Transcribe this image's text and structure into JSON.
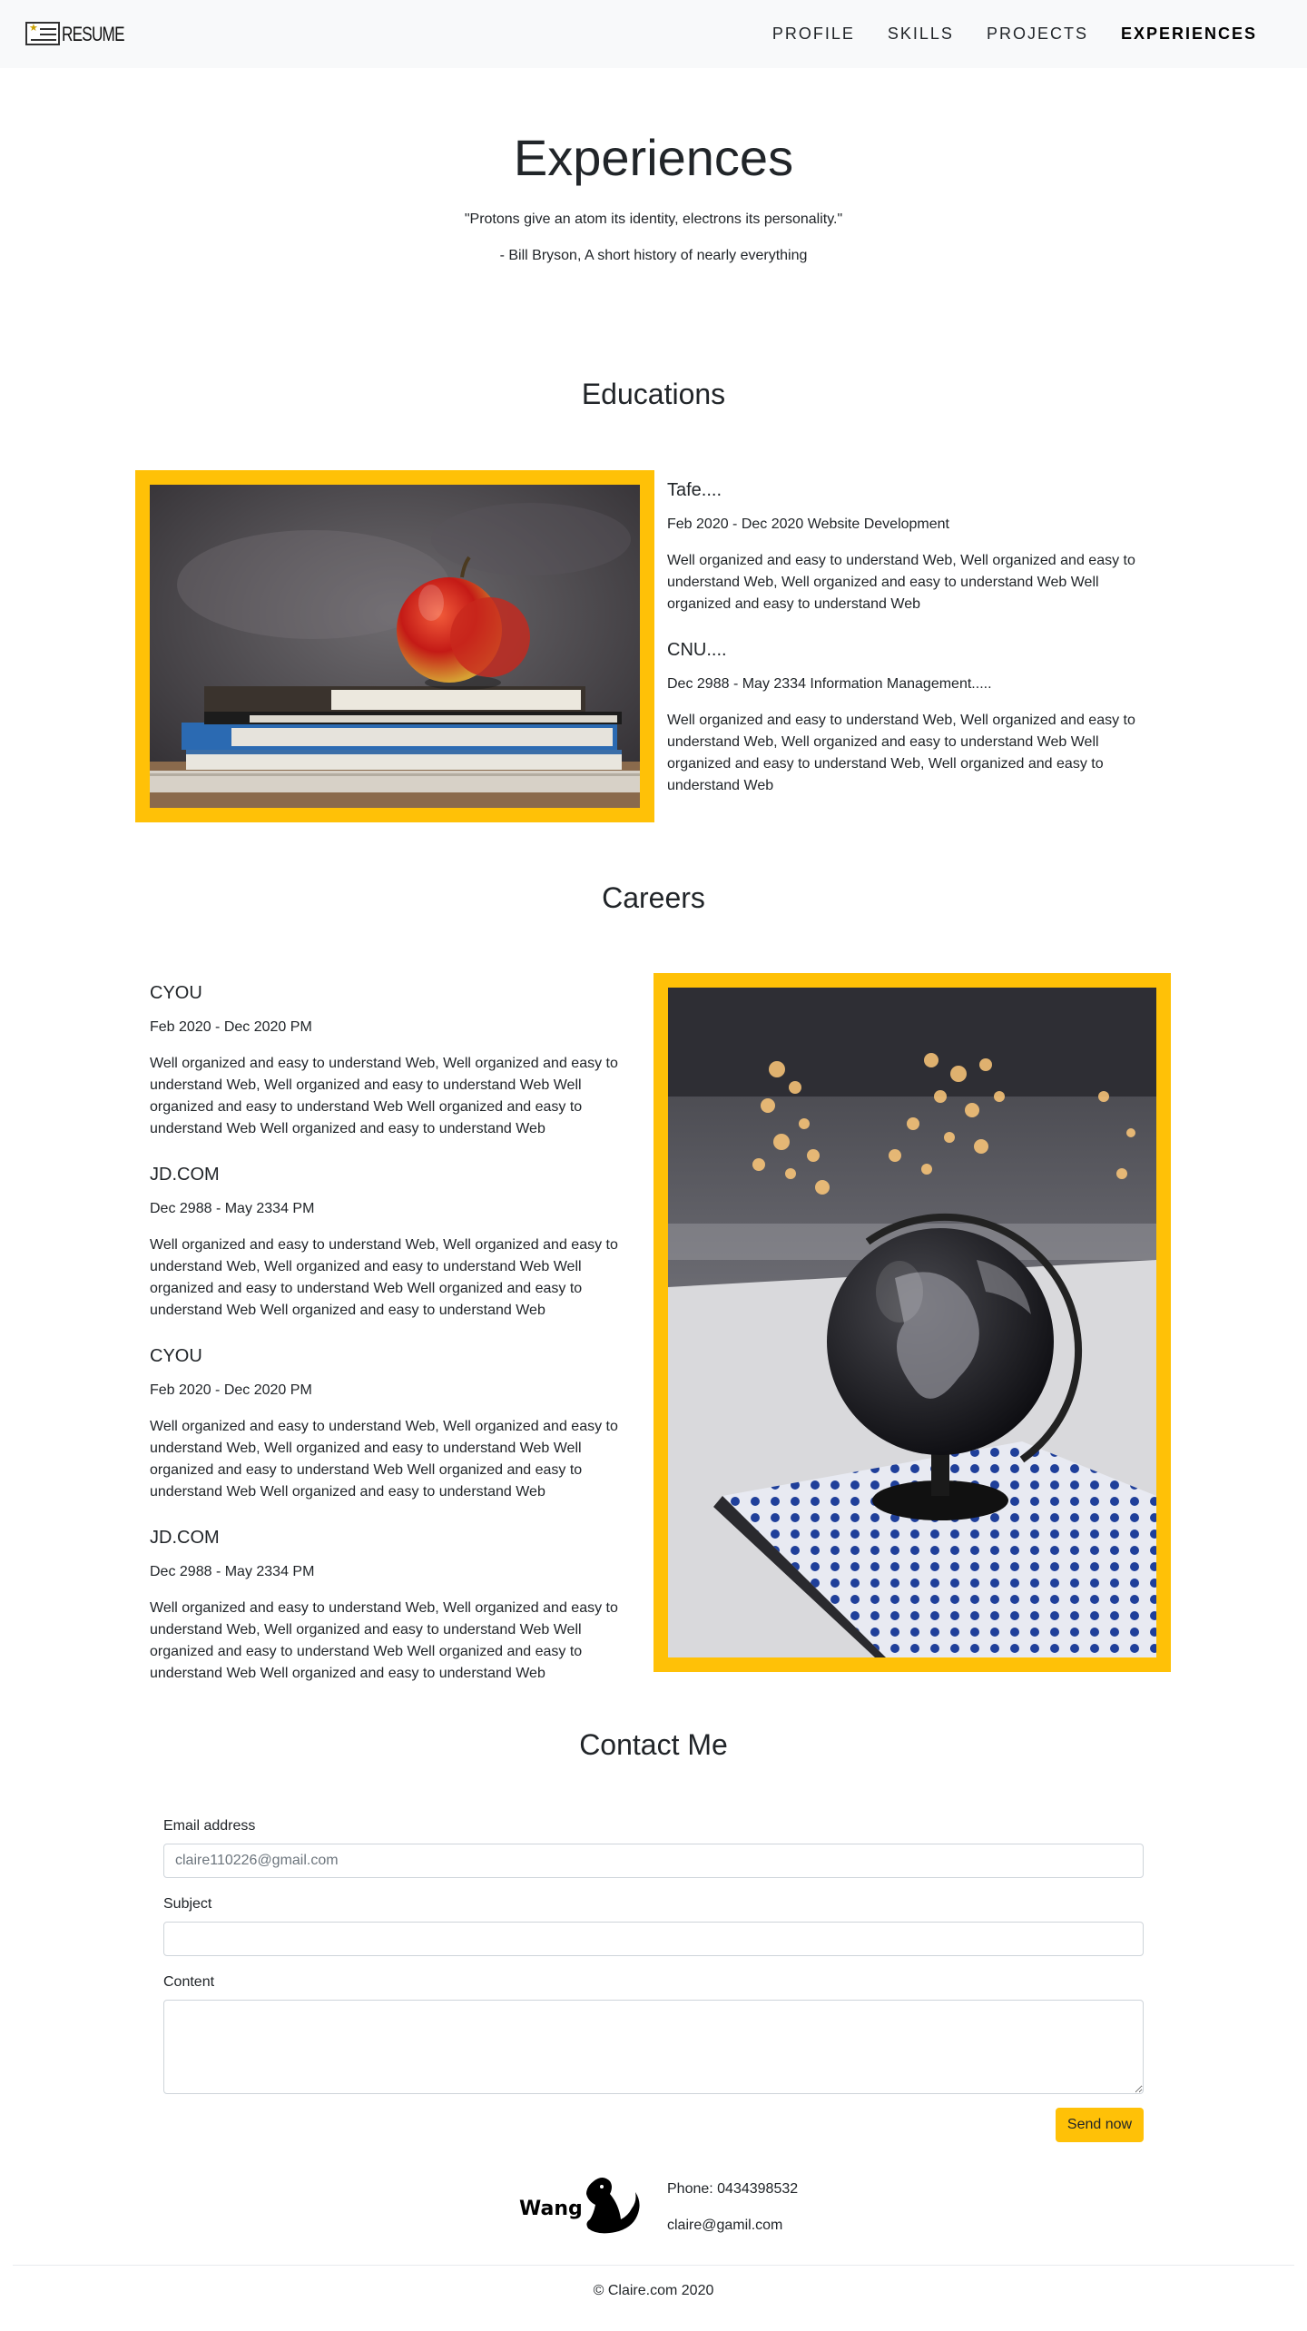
{
  "nav": {
    "brand": "RESUME",
    "links": [
      "PROFILE",
      "SKILLS",
      "PROJECTS",
      "EXPERIENCES"
    ],
    "active": "EXPERIENCES"
  },
  "header": {
    "title": "Experiences",
    "quote": "\"Protons give an atom its identity, electrons its personality.\"",
    "author": "- Bill Bryson, A short history of nearly everything"
  },
  "education": {
    "title": "Educations",
    "items": [
      {
        "name": "Tafe....",
        "date": "Feb 2020 - Dec 2020 Website Development",
        "desc": "Well organized and easy to understand Web, Well organized and easy to understand Web, Well organized and easy to understand Web Well organized and easy to understand Web"
      },
      {
        "name": "CNU....",
        "date": "Dec 2988 - May 2334 Information Management.....",
        "desc": "Well organized and easy to understand Web, Well organized and easy to understand Web, Well organized and easy to understand Web Well organized and easy to understand Web, Well organized and easy to understand Web"
      }
    ]
  },
  "careers": {
    "title": "Careers",
    "items": [
      {
        "name": "CYOU",
        "date": "Feb 2020 - Dec 2020 PM",
        "desc": "Well organized and easy to understand Web, Well organized and easy to understand Web, Well organized and easy to understand Web Well organized and easy to understand Web Well organized and easy to understand Web Well organized and easy to understand Web"
      },
      {
        "name": "JD.COM",
        "date": "Dec 2988 - May 2334 PM",
        "desc": "Well organized and easy to understand Web, Well organized and easy to understand Web, Well organized and easy to understand Web Well organized and easy to understand Web Well organized and easy to understand Web Well organized and easy to understand Web"
      },
      {
        "name": "CYOU",
        "date": "Feb 2020 - Dec 2020 PM",
        "desc": "Well organized and easy to understand Web, Well organized and easy to understand Web, Well organized and easy to understand Web Well organized and easy to understand Web Well organized and easy to understand Web Well organized and easy to understand Web"
      },
      {
        "name": "JD.COM",
        "date": "Dec 2988 - May 2334 PM",
        "desc": "Well organized and easy to understand Web, Well organized and easy to understand Web, Well organized and easy to understand Web Well organized and easy to understand Web Well organized and easy to understand Web Well organized and easy to understand Web"
      }
    ]
  },
  "contact": {
    "title": "Contact Me",
    "email_label": "Email address",
    "email_placeholder": "claire110226@gmail.com",
    "subject_label": "Subject",
    "content_label": "Content",
    "send_label": "Send now"
  },
  "footer": {
    "logo_text": "Wang",
    "phone": "Phone: 0434398532",
    "email": "claire@gamil.com",
    "copyright": "© Claire.com 2020"
  },
  "colors": {
    "accent": "#ffc107",
    "navbar_bg": "#f8f9fa",
    "text": "#212529"
  }
}
